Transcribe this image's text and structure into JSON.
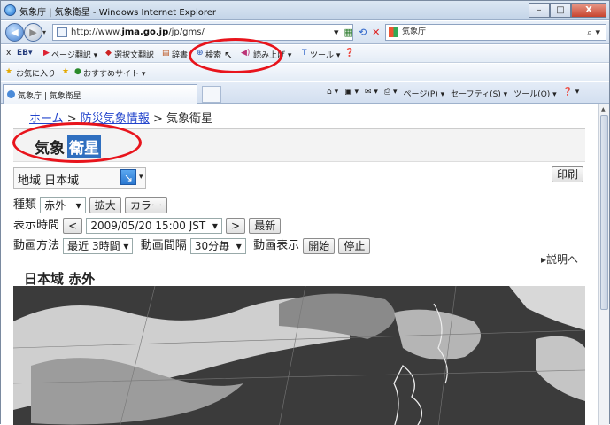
{
  "window": {
    "title": "気象庁 | 気象衛星 - Windows Internet Explorer",
    "min": "–",
    "max": "□",
    "close": "X"
  },
  "address": {
    "url_prefix": "http://www.",
    "url_domain": "jma.go.jp",
    "url_path": "/jp/gms/",
    "search_text": "気象庁"
  },
  "toolbar1": {
    "close": "x",
    "eb": "EB▾",
    "translate_page": "ページ翻訳 ▾",
    "translate_selection": "選択文翻訳",
    "dictionary": "辞書",
    "search": "検索",
    "read_aloud": "読み上げ ▾",
    "tools": "ツール ▾"
  },
  "toolbar2": {
    "favorites": "お気に入り",
    "suggested": "おすすめサイト ▾"
  },
  "tab": {
    "label": "気象庁 | 気象衛星"
  },
  "commands": [
    "⌂ ▾",
    "▣ ▾",
    "✉ ▾",
    "⎙ ▾",
    "ページ(P) ▾",
    "セーフティ(S) ▾",
    "ツール(O) ▾",
    "❓ ▾"
  ],
  "breadcrumb": {
    "home": "ホーム",
    "sep1": " > ",
    "disaster": "防災気象情報",
    "sep2": " > ",
    "current": "気象衛星"
  },
  "heading": {
    "part1": "気象",
    "part2": "衛星"
  },
  "region": {
    "label": "地域",
    "value": "日本域"
  },
  "print_label": "印刷",
  "type": {
    "label": "種類",
    "value": "赤外",
    "enlarge": "拡大",
    "color": "カラー"
  },
  "time": {
    "label": "表示時間",
    "prev": "<",
    "value": "2009/05/20 15:00 JST",
    "next": ">",
    "latest": "最新"
  },
  "animation": {
    "method_label": "動画方法",
    "method_value": "最近 3時間",
    "interval_label": "動画間隔",
    "interval_value": "30分毎",
    "display_label": "動画表示",
    "start": "開始",
    "stop": "停止"
  },
  "explain_link": "▸説明へ",
  "section_title": "日本域 赤外"
}
